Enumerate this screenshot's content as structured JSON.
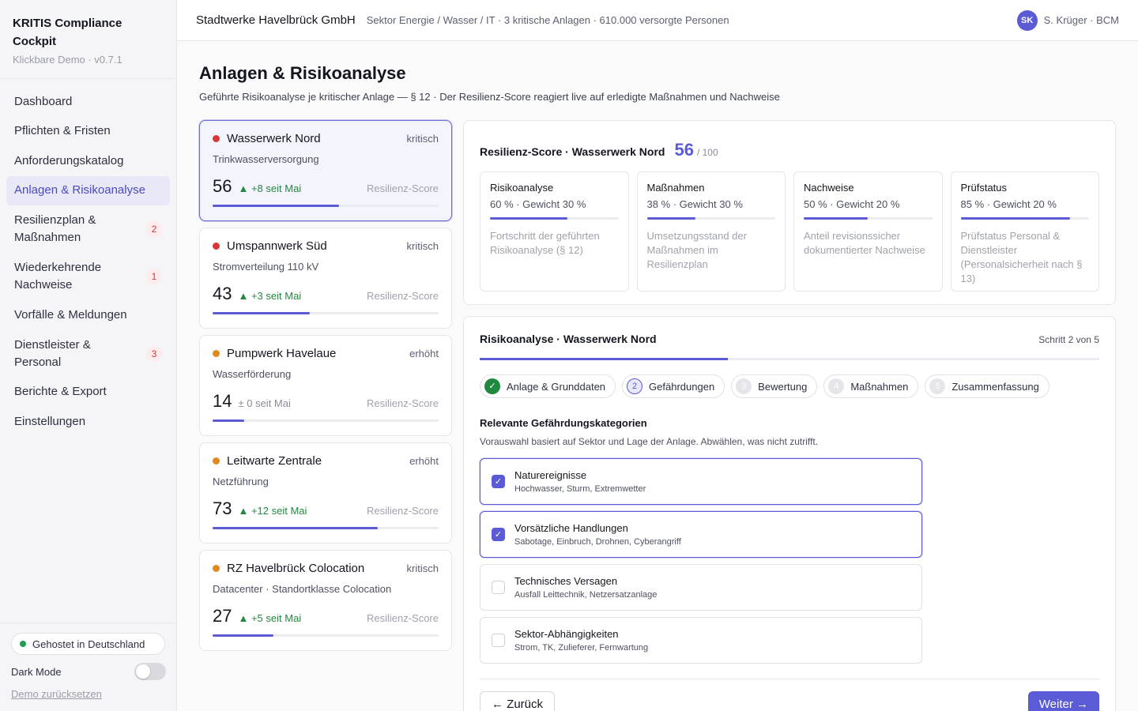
{
  "app": {
    "title": "KRITIS Compliance Cockpit",
    "subtitle": "Klickbare Demo · v0.7.1"
  },
  "nav": [
    {
      "label": "Dashboard",
      "badge": ""
    },
    {
      "label": "Pflichten & Fristen",
      "badge": ""
    },
    {
      "label": "Anforderungskatalog",
      "badge": ""
    },
    {
      "label": "Anlagen & Risikoanalyse",
      "badge": ""
    },
    {
      "label": "Resilienzplan & Maßnahmen",
      "badge": "2"
    },
    {
      "label": "Wiederkehrende Nachweise",
      "badge": "1"
    },
    {
      "label": "Vorfälle & Meldungen",
      "badge": ""
    },
    {
      "label": "Dienstleister & Personal",
      "badge": "3"
    },
    {
      "label": "Berichte & Export",
      "badge": ""
    },
    {
      "label": "Einstellungen",
      "badge": ""
    }
  ],
  "sidebar_footer": {
    "hosted": "Gehostet in Deutschland",
    "dark_mode": "Dark Mode",
    "reset": "Demo zurücksetzen"
  },
  "topbar": {
    "org": "Stadtwerke Havelbrück GmbH",
    "meta": "Sektor Energie / Wasser / IT · 3 kritische Anlagen · 610.000 versorgte Personen",
    "avatar": "SK",
    "user": "S. Krüger · BCM"
  },
  "page": {
    "title": "Anlagen & Risikoanalyse",
    "subtitle": "Geführte Risikoanalyse je kritischer Anlage — § 12 · Der Resilienz-Score reagiert live auf erledigte Maßnahmen und Nachweise"
  },
  "assets": [
    {
      "name": "Wasserwerk Nord",
      "level": "kritisch",
      "type": "Trinkwasserversorgung",
      "score": "56",
      "delta": "▲ +8 seit Mai",
      "trend": "up",
      "score_label": "Resilienz-Score",
      "score_value": 56,
      "color": "#d93636"
    },
    {
      "name": "Umspannwerk Süd",
      "level": "kritisch",
      "type": "Stromverteilung 110 kV",
      "score": "43",
      "delta": "▲ +3 seit Mai",
      "trend": "up",
      "score_label": "Resilienz-Score",
      "score_value": 43,
      "color": "#d93636"
    },
    {
      "name": "Pumpwerk Havelaue",
      "level": "erhöht",
      "type": "Wasserförderung",
      "score": "14",
      "delta": "± 0 seit Mai",
      "trend": "flat",
      "score_label": "Resilienz-Score",
      "score_value": 14,
      "color": "#e08a1e"
    },
    {
      "name": "Leitwarte Zentrale",
      "level": "erhöht",
      "type": "Netzführung",
      "score": "73",
      "delta": "▲ +12 seit Mai",
      "trend": "up",
      "score_label": "Resilienz-Score",
      "score_value": 73,
      "color": "#e08a1e"
    },
    {
      "name": "RZ Havelbrück Colocation",
      "level": "kritisch",
      "type": "Datacenter · Standortklasse Colocation",
      "score": "27",
      "delta": "▲ +5 seit Mai",
      "trend": "up",
      "score_label": "Resilienz-Score",
      "score_value": 27,
      "color": "#e08a1e"
    }
  ],
  "score_panel": {
    "title": "Resilienz-Score · Wasserwerk Nord",
    "score": "56",
    "of": "/ 100",
    "metrics": [
      {
        "name": "Risikoanalyse",
        "value": "60 % · Gewicht 30 %",
        "progress": 60,
        "desc": "Fortschritt der geführten Risikoanalyse (§ 12)"
      },
      {
        "name": "Maßnahmen",
        "value": "38 % · Gewicht 30 %",
        "progress": 38,
        "desc": "Umsetzungsstand der Maßnahmen im Resilienzplan"
      },
      {
        "name": "Nachweise",
        "value": "50 % · Gewicht 20 %",
        "progress": 50,
        "desc": "Anteil revisionssicher dokumentierter Nachweise"
      },
      {
        "name": "Prüfstatus",
        "value": "85 % · Gewicht 20 %",
        "progress": 85,
        "desc": "Prüfstatus Personal & Dienstleister (Personalsicherheit nach § 13)"
      }
    ]
  },
  "wizard": {
    "title": "Risikoanalyse · Wasserwerk Nord",
    "step_text": "Schritt 2 von 5",
    "progress": 40,
    "steps": [
      {
        "num": "✓",
        "label": "Anlage & Grunddaten",
        "state": "done"
      },
      {
        "num": "2",
        "label": "Gefährdungen",
        "state": "current"
      },
      {
        "num": "3",
        "label": "Bewertung",
        "state": "todo"
      },
      {
        "num": "4",
        "label": "Maßnahmen",
        "state": "todo"
      },
      {
        "num": "5",
        "label": "Zusammenfassung",
        "state": "todo"
      }
    ],
    "section_title": "Relevante Gefährdungskategorien",
    "section_sub": "Vorauswahl basiert auf Sektor und Lage der Anlage. Abwählen, was nicht zutrifft.",
    "options": [
      {
        "name": "Naturereignisse",
        "desc": "Hochwasser, Sturm, Extremwetter",
        "checked": true
      },
      {
        "name": "Vorsätzliche Handlungen",
        "desc": "Sabotage, Einbruch, Drohnen, Cyberangriff",
        "checked": true
      },
      {
        "name": "Technisches Versagen",
        "desc": "Ausfall Leittechnik, Netzersatzanlage",
        "checked": false
      },
      {
        "name": "Sektor-Abhängigkeiten",
        "desc": "Strom, TK, Zulieferer, Fernwartung",
        "checked": false
      }
    ],
    "back": "← Zurück",
    "next": "Weiter →"
  }
}
